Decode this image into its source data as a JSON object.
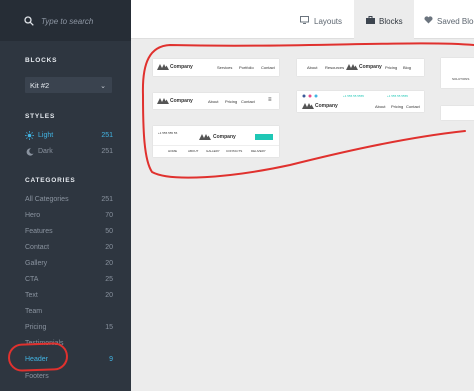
{
  "search": {
    "placeholder": "Type to search"
  },
  "tabs": [
    {
      "label": "Layouts",
      "icon": "monitor-icon"
    },
    {
      "label": "Blocks",
      "icon": "briefcase-icon"
    },
    {
      "label": "Saved Block",
      "icon": "heart-icon"
    }
  ],
  "active_tab": "Blocks",
  "sidebar": {
    "blocks_title": "BLOCKS",
    "kit_value": "Kit #2",
    "styles_title": "STYLES",
    "styles": [
      {
        "label": "Light",
        "count": "251",
        "icon": "sun-icon"
      },
      {
        "label": "Dark",
        "count": "251",
        "icon": "moon-icon"
      }
    ],
    "categories_title": "CATEGORIES",
    "categories": [
      {
        "label": "All Categories",
        "count": "251"
      },
      {
        "label": "Hero",
        "count": "70"
      },
      {
        "label": "Features",
        "count": "50"
      },
      {
        "label": "Contact",
        "count": "20"
      },
      {
        "label": "Gallery",
        "count": "20"
      },
      {
        "label": "CTA",
        "count": "25"
      },
      {
        "label": "Text",
        "count": "20"
      },
      {
        "label": "Team",
        "count": ""
      },
      {
        "label": "Pricing",
        "count": "15"
      },
      {
        "label": "Testimonials",
        "count": ""
      },
      {
        "label": "Header",
        "count": "9"
      },
      {
        "label": "Footers",
        "count": ""
      }
    ]
  },
  "cards": {
    "c1": {
      "brand": "Company",
      "links": [
        "Services",
        "Portfolio",
        "Contact"
      ]
    },
    "c2": {
      "brand": "Company",
      "links_left": [
        "About",
        "Resources"
      ],
      "links_right": [
        "Pricing",
        "Blog"
      ]
    },
    "c3": {
      "brand": "Company",
      "links": [
        "About",
        "Pricing",
        "Contact"
      ]
    },
    "c4": {
      "brand": "Company",
      "contact": "+1 555 55 5555",
      "links": [
        "About",
        "Pricing",
        "Contact"
      ]
    },
    "c5": {
      "brand": "Company",
      "small": "+1 555 555 55",
      "links": [
        "HOME",
        "ABOUT",
        "GALLERY",
        "CONTACTS",
        "DELIVERY"
      ]
    },
    "c6": {
      "label": "SOLUTIONS"
    }
  },
  "colors": {
    "accent": "#42b4e3",
    "sidebar": "#2e3640",
    "annotation": "#e0312e",
    "teal": "#1fc7b5"
  }
}
